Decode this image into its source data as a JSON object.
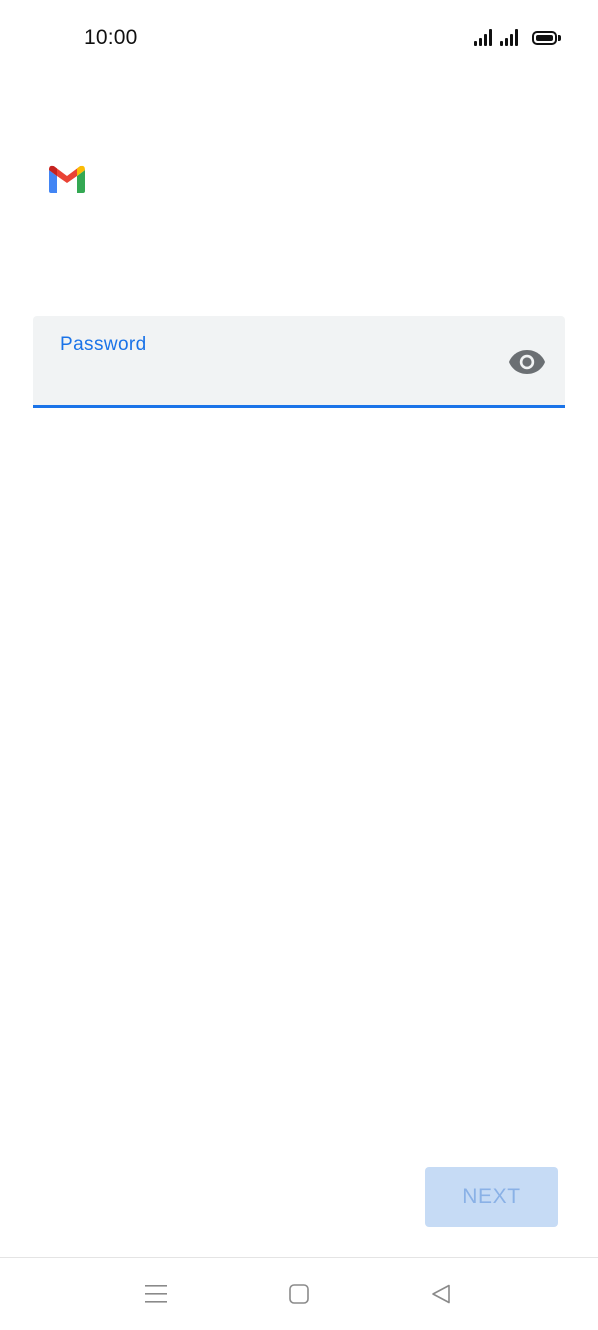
{
  "status_bar": {
    "time": "10:00",
    "icons": [
      "signal-icon",
      "signal-icon",
      "battery-icon"
    ]
  },
  "app": {
    "logo": "gmail-logo"
  },
  "password_field": {
    "label": "Password",
    "value": "",
    "toggle_icon": "eye-icon"
  },
  "actions": {
    "next_label": "NEXT"
  },
  "nav_bar": {
    "icons": [
      "menu-icon",
      "home-icon",
      "back-icon"
    ]
  },
  "colors": {
    "accent": "#1a73e8",
    "field_bg": "#f1f3f4",
    "next_bg": "#c6dbf5",
    "next_text": "#8ab1e6"
  }
}
